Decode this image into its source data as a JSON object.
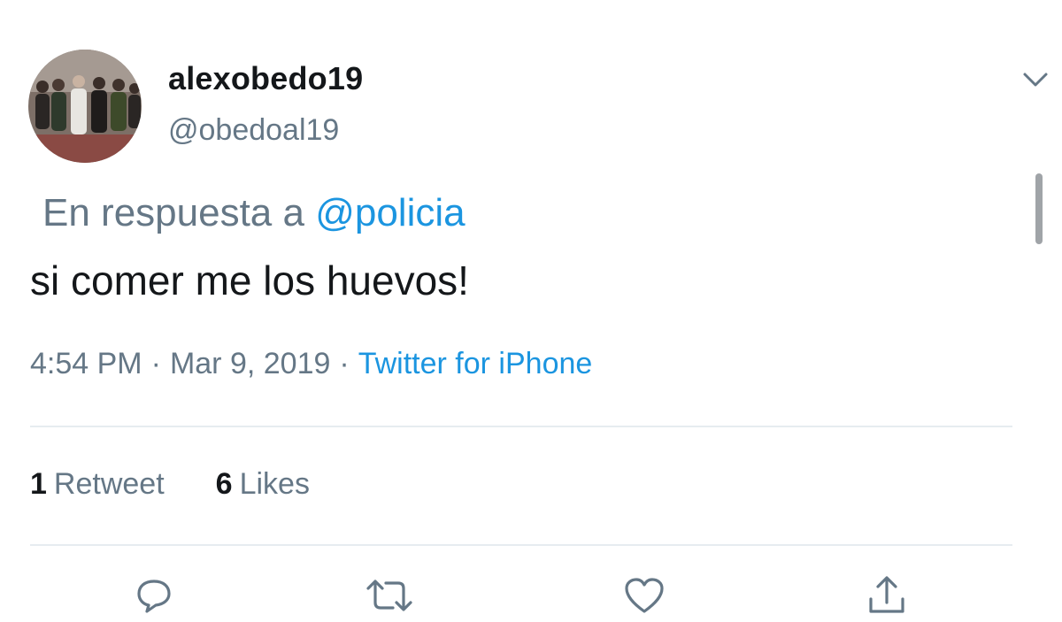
{
  "author": {
    "display_name": "alexobedo19",
    "handle": "@obedoal19"
  },
  "reply": {
    "prefix": "En respuesta a",
    "mention": "@policia"
  },
  "tweet": {
    "text": "si comer me los huevos!"
  },
  "meta": {
    "time": "4:54 PM",
    "separator": "·",
    "date": "Mar 9, 2019",
    "source": "Twitter for iPhone"
  },
  "stats": {
    "retweets": {
      "count": "1",
      "label": "Retweet"
    },
    "likes": {
      "count": "6",
      "label": "Likes"
    }
  },
  "actions": [
    {
      "name": "reply",
      "icon": "reply-icon"
    },
    {
      "name": "retweet",
      "icon": "retweet-icon"
    },
    {
      "name": "like",
      "icon": "heart-icon"
    },
    {
      "name": "share",
      "icon": "share-icon"
    }
  ],
  "colors": {
    "link": "#1b95e0",
    "secondary_text": "#657786",
    "primary_text": "#14171a",
    "divider": "#e6ecf0"
  }
}
